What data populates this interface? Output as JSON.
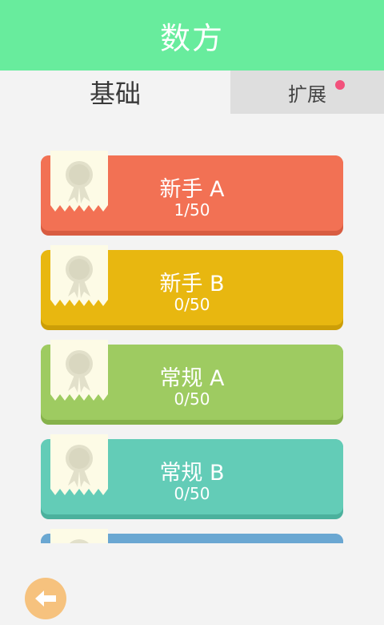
{
  "app": {
    "title": "数方"
  },
  "tabs": [
    {
      "label": "基础",
      "selected": true
    },
    {
      "label": "扩展",
      "selected": false,
      "has_notification": true
    }
  ],
  "levels": [
    {
      "name": "新手 A",
      "progress": "1/50",
      "color": "#f27154",
      "shade": "#d85c41"
    },
    {
      "name": "新手 B",
      "progress": "0/50",
      "color": "#e8b710",
      "shade": "#cc9e07"
    },
    {
      "name": "常规 A",
      "progress": "0/50",
      "color": "#9ecb61",
      "shade": "#86b24b"
    },
    {
      "name": "常规 B",
      "progress": "0/50",
      "color": "#63ccb7",
      "shade": "#4bb19d"
    },
    {
      "name": "",
      "progress": "",
      "color": "#6aa7d2",
      "shade": "#4f8ab6"
    }
  ],
  "icons": {
    "back": "arrow-left-icon",
    "badge": "award-ribbon-icon"
  }
}
